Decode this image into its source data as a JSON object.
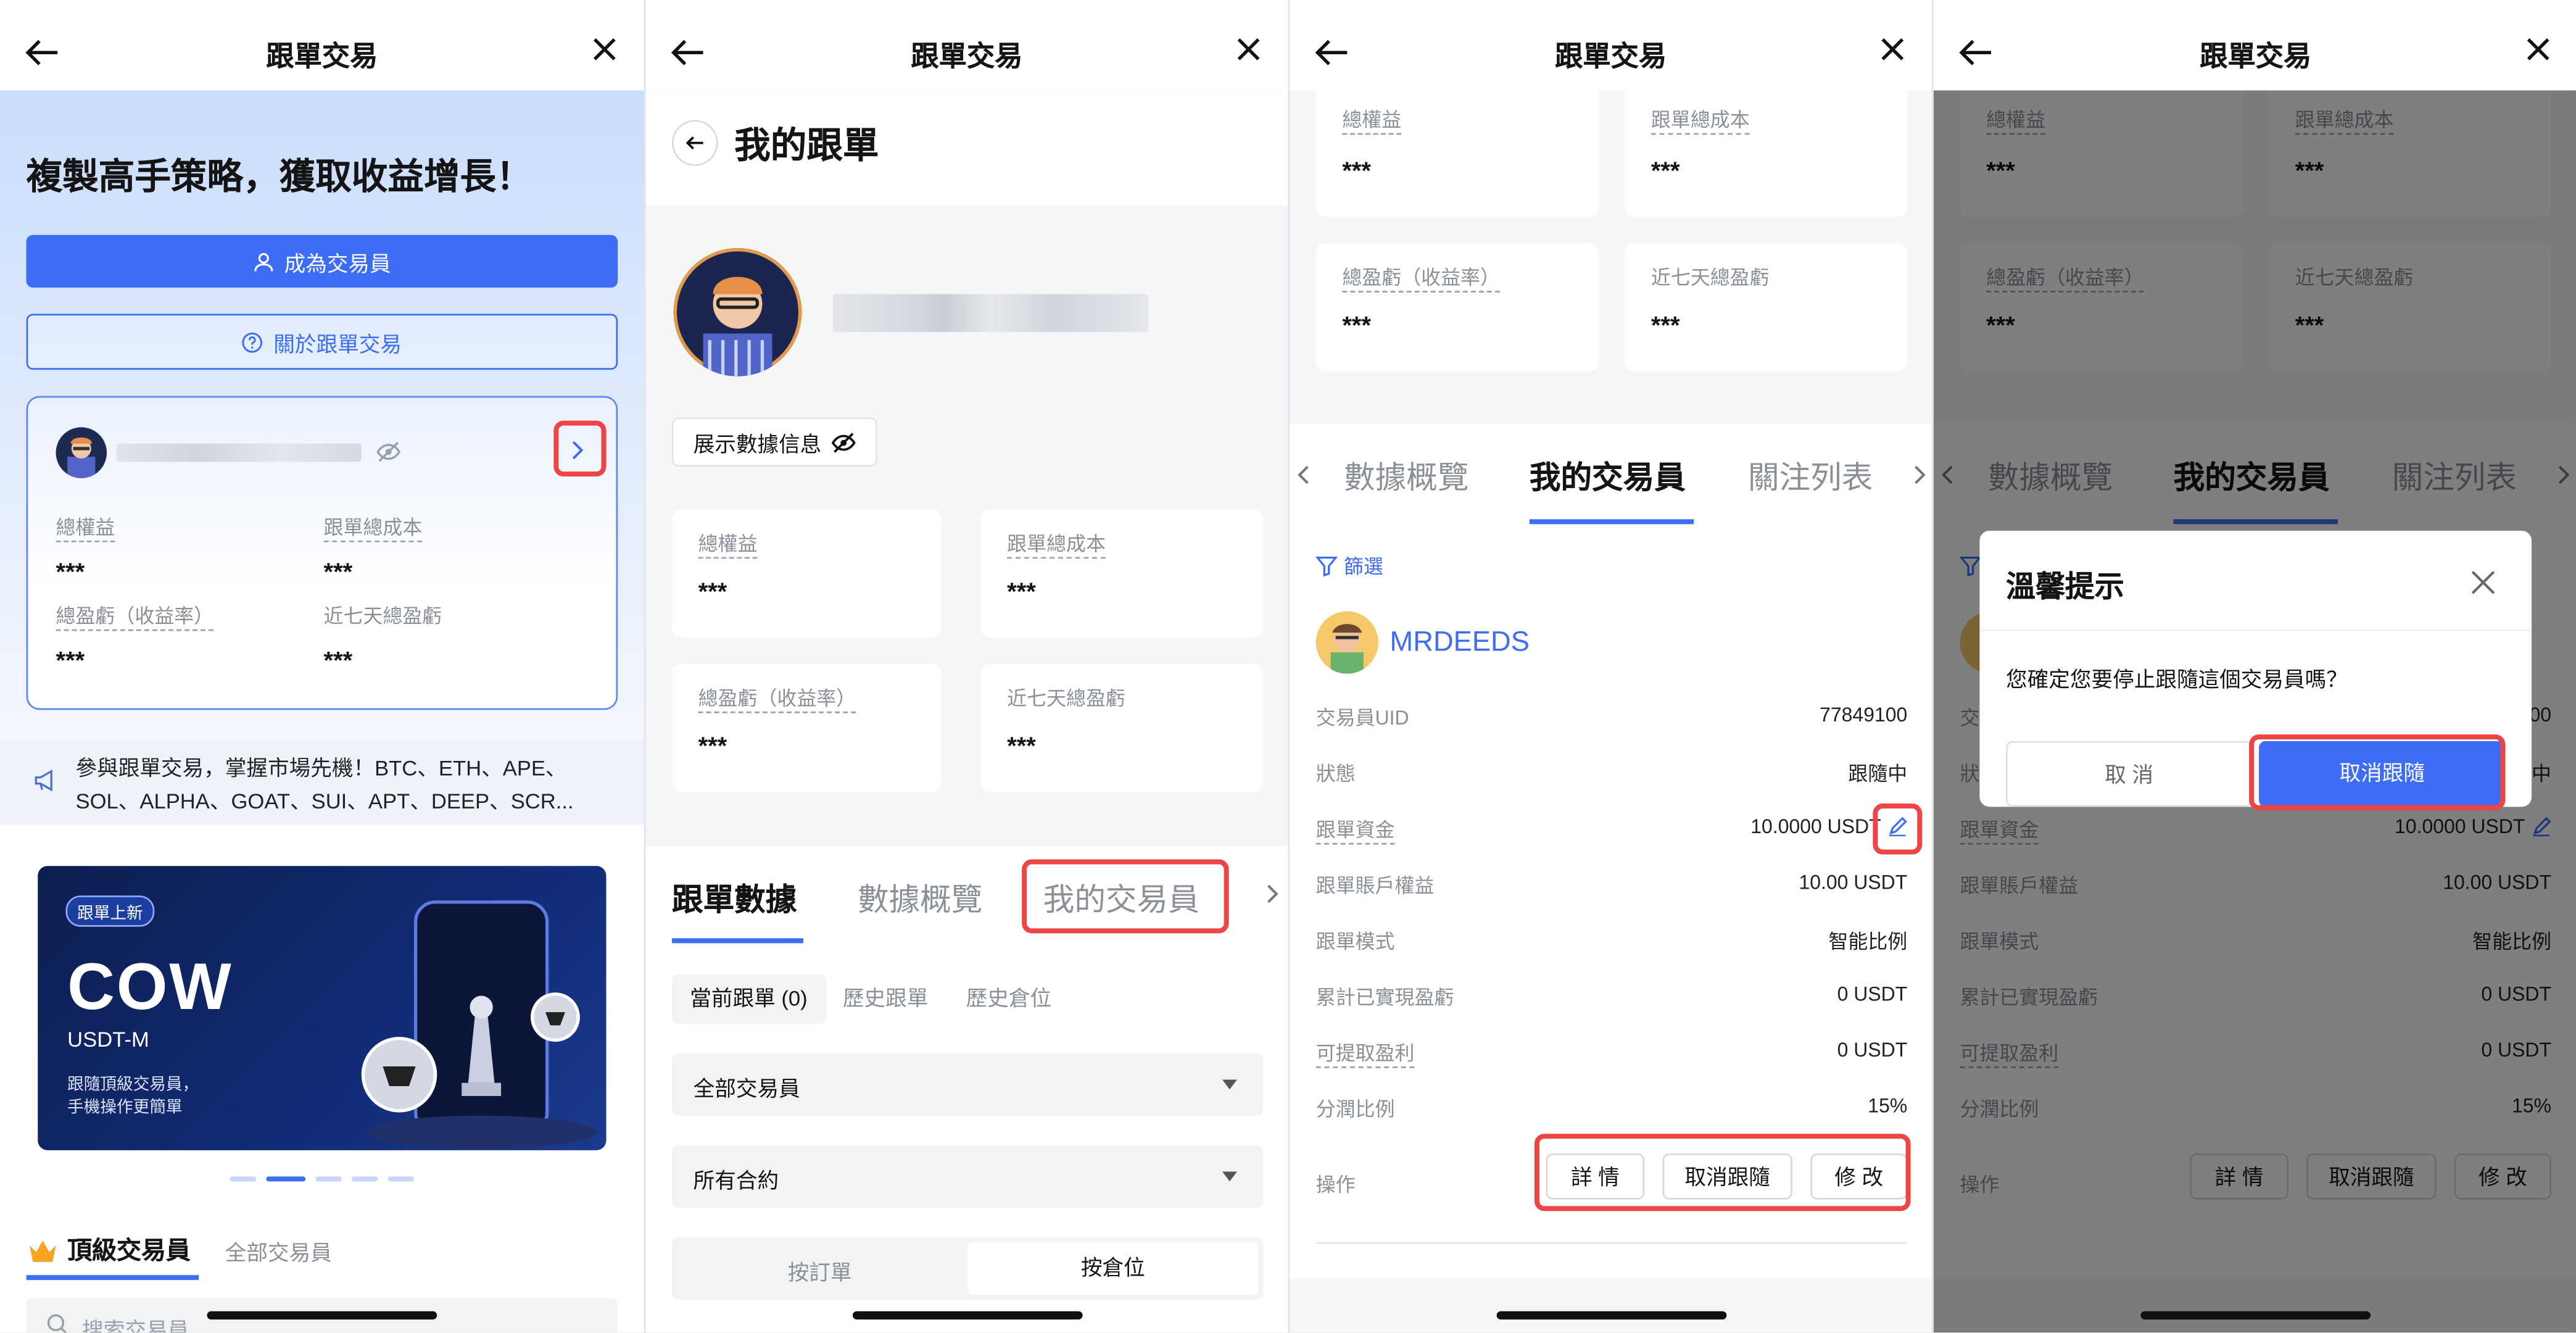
{
  "header": {
    "title": "跟單交易"
  },
  "p1": {
    "hero_title": "複製高手策略，獲取收益增長！",
    "become_trader": "成為交易員",
    "about": "關於跟單交易",
    "stats": {
      "total_equity": "總權益",
      "copy_cost": "跟單總成本",
      "pnl_rate": "總盈虧（收益率）",
      "pnl_7d": "近七天總盈虧",
      "masked": "***"
    },
    "announcement": "參與跟單交易，掌握市場先機！BTC、ETH、APE、SOL、ALPHA、GOAT、SUI、APT、DEEP、SCR...",
    "banner": {
      "badge": "跟單上新",
      "coin": "COW",
      "pair": "USDT-M",
      "line1": "跟隨頂級交易員，",
      "line2": "手機操作更簡單"
    },
    "tabs": {
      "top": "頂級交易員",
      "all": "全部交易員"
    },
    "search_placeholder": "搜索交易員"
  },
  "p2": {
    "page_title": "我的跟單",
    "show_data": "展示數據信息",
    "tabs": [
      "跟單數據",
      "數據概覽",
      "我的交易員"
    ],
    "subtabs": [
      "當前跟單 (0)",
      "歷史跟單",
      "歷史倉位"
    ],
    "filter_traders": "全部交易員",
    "filter_contracts": "所有合約",
    "toggle": [
      "按訂單",
      "按倉位"
    ]
  },
  "p3": {
    "tabs": [
      "數據概覽",
      "我的交易員",
      "關注列表"
    ],
    "filter": "篩選",
    "trader_name": "MRDEEDS",
    "rows": [
      {
        "k": "交易員UID",
        "v": "77849100"
      },
      {
        "k": "狀態",
        "v": "跟隨中"
      },
      {
        "k": "跟單資金",
        "v": "10.0000 USDT"
      },
      {
        "k": "跟單賬戶權益",
        "v": "10.00 USDT"
      },
      {
        "k": "跟單模式",
        "v": "智能比例"
      },
      {
        "k": "累計已實現盈虧",
        "v": "0 USDT"
      },
      {
        "k": "可提取盈利",
        "v": "0 USDT"
      },
      {
        "k": "分潤比例",
        "v": "15%"
      }
    ],
    "action_label": "操作",
    "actions": [
      "詳 情",
      "取消跟隨",
      "修 改"
    ]
  },
  "p4": {
    "dialog_title": "溫馨提示",
    "dialog_msg": "您確定您要停止跟隨這個交易員嗎？",
    "cancel": "取 消",
    "confirm": "取消跟隨"
  },
  "colors": {
    "accent": "#3d6cf5",
    "highlight": "#ef4444"
  }
}
